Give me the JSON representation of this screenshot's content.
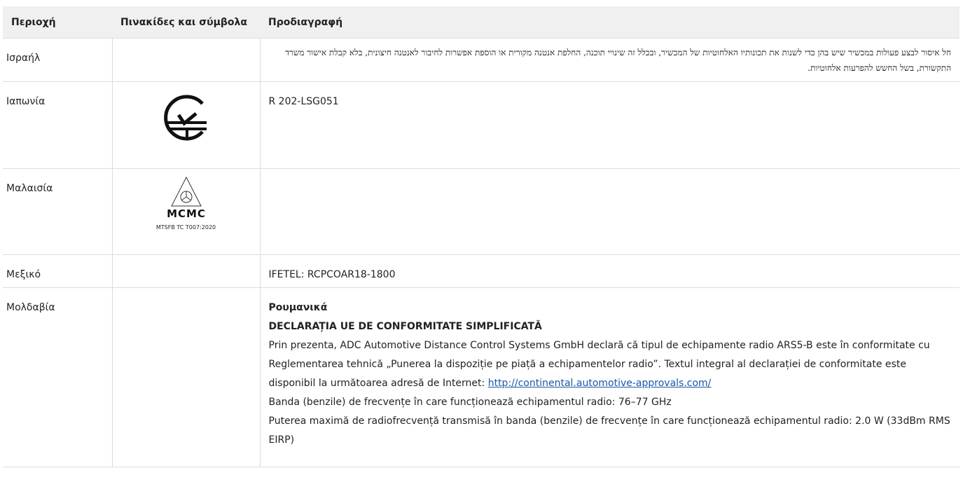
{
  "table": {
    "headers": {
      "region": "Περιοχή",
      "symbols": "Πινακίδες και σύμβολα",
      "spec": "Προδιαγραφή"
    },
    "rows": {
      "israel": {
        "region": "Ισραήλ",
        "spec": "חל איסור לבצע פעולות במכשיר שיש בהן כדי לשנות את תכונותיו האלחוטיות של המכשיר, ובכלל זה שינויי תוכנה, החלפת אנטנה מקורית או הוספת אפשרות לחיבור לאנטנה חיצונית, בלא קבלת אישור משרד התקשורת, בשל החשש להפרעות אלחוטיות."
      },
      "japan": {
        "region": "Ιαπωνία",
        "symbol_icon": "japan-giteki-mark",
        "spec": "R 202-LSG051"
      },
      "malaysia": {
        "region": "Μαλαισία",
        "symbol_icon": "mcmc-logo",
        "symbol_brand": "MCMC",
        "symbol_caption": "MTSFB TC T007:2020",
        "spec": ""
      },
      "mexico": {
        "region": "Μεξικό",
        "spec": "IFETEL: RCPCOAR18-1800"
      },
      "moldova": {
        "region": "Μολδαβία",
        "language": "Ρουμανικά",
        "heading": "DECLARAȚIA UE DE CONFORMITATE SIMPLIFICATĂ",
        "paragraph": "Prin prezenta, ADC Automotive Distance Control Systems GmbH declară că tipul de echipamente radio ARS5-B este în conformitate cu Reglementarea tehnică „Punerea la dispoziție pe piață a echipamentelor radio”. Textul integral al declarației de conformitate este disponibil la următoarea adresă de Internet: ",
        "link": "http://continental.automotive-approvals.com/",
        "band": "Banda (benzile) de frecvențe în care funcționează echipamentul radio: 76–77 GHz",
        "power": "Puterea maximă de radiofrecvență transmisă în banda (benzile) de frecvențe în care funcționează echipamentul radio: 2.0 W (33dBm RMS EIRP)"
      }
    }
  }
}
